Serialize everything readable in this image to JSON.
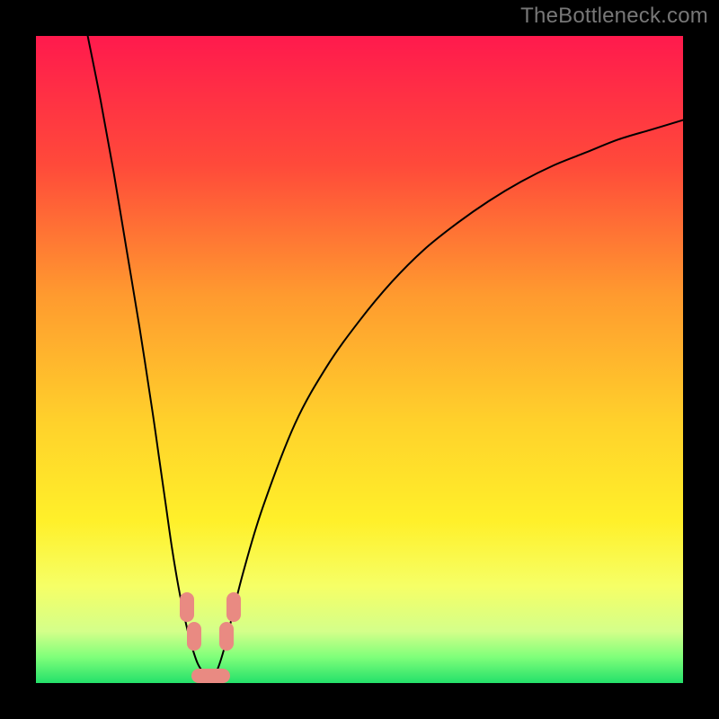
{
  "watermark": "TheBottleneck.com",
  "chart_data": {
    "type": "line",
    "title": "",
    "xlabel": "",
    "ylabel": "",
    "xlim": [
      0,
      100
    ],
    "ylim": [
      0,
      100
    ],
    "gradient_stops": [
      {
        "offset": 0,
        "color": "#ff1a4d"
      },
      {
        "offset": 20,
        "color": "#ff4a3a"
      },
      {
        "offset": 40,
        "color": "#ff9a2f"
      },
      {
        "offset": 60,
        "color": "#ffd22b"
      },
      {
        "offset": 75,
        "color": "#fff02a"
      },
      {
        "offset": 85,
        "color": "#f6ff66"
      },
      {
        "offset": 92,
        "color": "#d4ff8a"
      },
      {
        "offset": 96,
        "color": "#7fff7a"
      },
      {
        "offset": 100,
        "color": "#24e06a"
      }
    ],
    "series": [
      {
        "name": "left-branch",
        "x": [
          8.0,
          10.0,
          12.0,
          14.0,
          16.0,
          18.0,
          19.0,
          20.0,
          21.0,
          22.0,
          23.0,
          24.0,
          25.0,
          26.0,
          27.0
        ],
        "y": [
          100.0,
          90.0,
          79.0,
          67.0,
          55.0,
          42.0,
          35.0,
          28.0,
          21.0,
          15.0,
          10.0,
          6.0,
          3.0,
          1.5,
          0.5
        ]
      },
      {
        "name": "right-branch",
        "x": [
          27.0,
          28.0,
          29.0,
          30.0,
          32.0,
          35.0,
          40.0,
          45.0,
          50.0,
          55.0,
          60.0,
          65.0,
          70.0,
          75.0,
          80.0,
          85.0,
          90.0,
          95.0,
          100.0
        ],
        "y": [
          0.5,
          2.0,
          5.0,
          9.0,
          17.0,
          27.0,
          40.0,
          49.0,
          56.0,
          62.0,
          67.0,
          71.0,
          74.5,
          77.5,
          80.0,
          82.0,
          84.0,
          85.5,
          87.0
        ]
      }
    ],
    "markers": [
      {
        "name": "left-upper",
        "x": 22.2,
        "y": 9.5,
        "w": 2.2,
        "h": 4.5
      },
      {
        "name": "left-lower",
        "x": 23.3,
        "y": 5.0,
        "w": 2.2,
        "h": 4.5
      },
      {
        "name": "right-upper",
        "x": 29.4,
        "y": 9.5,
        "w": 2.2,
        "h": 4.5
      },
      {
        "name": "right-lower",
        "x": 28.3,
        "y": 5.0,
        "w": 2.2,
        "h": 4.5
      },
      {
        "name": "bottom-bar",
        "x": 24.0,
        "y": 0.0,
        "w": 6.0,
        "h": 2.2
      }
    ]
  }
}
